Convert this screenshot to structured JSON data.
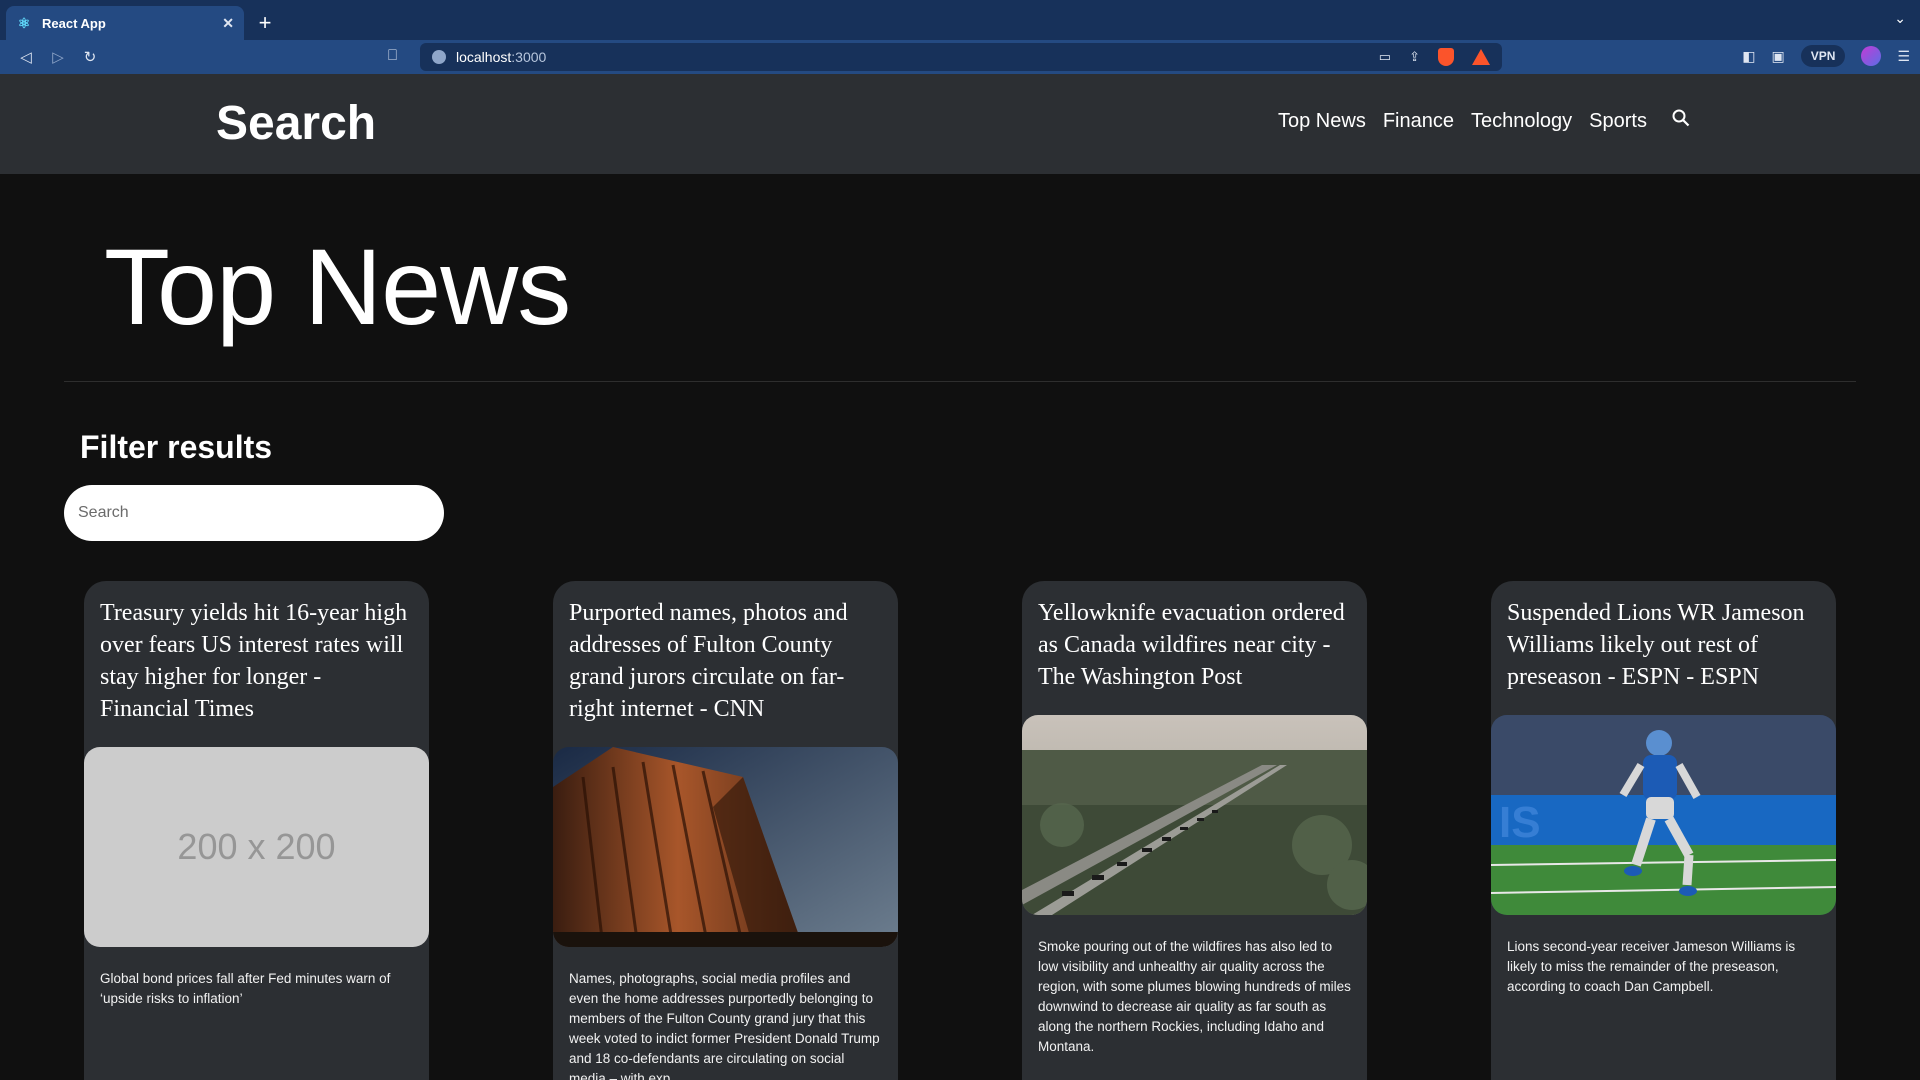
{
  "browser": {
    "tab_title": "React App",
    "url_host": "localhost",
    "url_port": ":3000",
    "vpn_label": "VPN",
    "new_tab_label": "+"
  },
  "header": {
    "brand": "Search",
    "nav": [
      "Top News",
      "Finance",
      "Technology",
      "Sports"
    ]
  },
  "main": {
    "title": "Top News",
    "filter_heading": "Filter results",
    "search_placeholder": "Search"
  },
  "articles": [
    {
      "title": "Treasury yields hit 16-year high over fears US interest rates will stay higher for longer - Financial Times",
      "image": "placeholder",
      "image_label": "200 x 200",
      "description": "Global bond prices fall after Fed minutes warn of ‘upside risks to inflation’"
    },
    {
      "title": "Purported names, photos and addresses of Fulton County grand jurors circulate on far-right internet - CNN",
      "image": "building-photo",
      "description": "Names, photographs, social media profiles and even the home addresses purportedly belonging to members of the Fulton County grand jury that this week voted to indict former President Donald Trump and 18 co-defendants are circulating on social media – with exp…"
    },
    {
      "title": "Yellowknife evacuation ordered as Canada wildfires near city - The Washington Post",
      "image": "highway-photo",
      "description": "Smoke pouring out of the wildfires has also led to low visibility and unhealthy air quality across the region, with some plumes blowing hundreds of miles downwind to decrease air quality as far south as along the northern Rockies, including Idaho and Montana."
    },
    {
      "title": "Suspended Lions WR Jameson Williams likely out rest of preseason - ESPN - ESPN",
      "image": "football-photo",
      "description": "Lions second-year receiver Jameson Williams is likely to miss the remainder of the preseason, according to coach Dan Campbell."
    }
  ],
  "colors": {
    "browser_tabbar": "#17315a",
    "browser_toolbar": "#244a82",
    "header_bg": "#2c2f33",
    "page_bg": "#101010",
    "card_bg": "#2c2f33"
  }
}
